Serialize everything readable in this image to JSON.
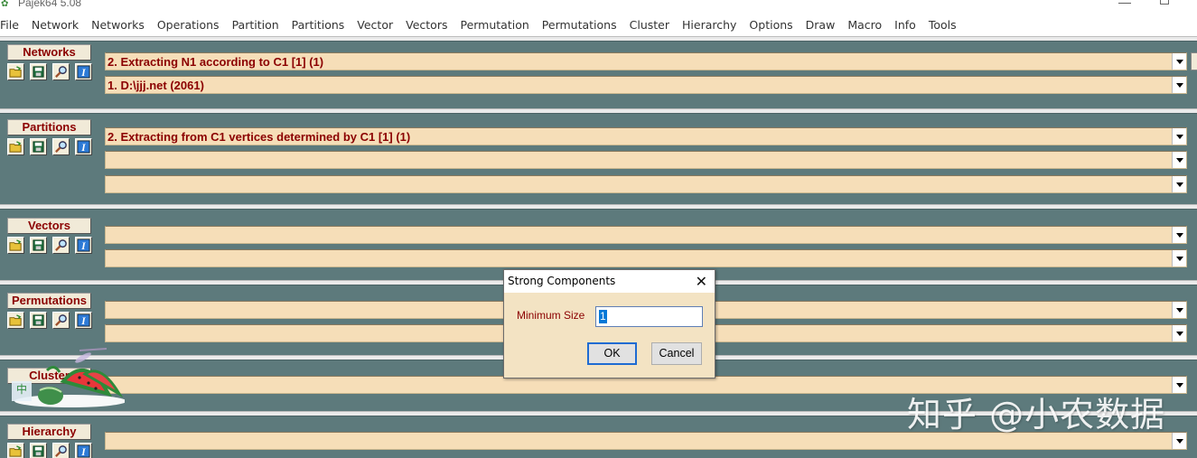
{
  "window": {
    "title": "Pajek64 5.08"
  },
  "menu": [
    "File",
    "Network",
    "Networks",
    "Operations",
    "Partition",
    "Partitions",
    "Vector",
    "Vectors",
    "Permutation",
    "Permutations",
    "Cluster",
    "Hierarchy",
    "Options",
    "Draw",
    "Macro",
    "Info",
    "Tools"
  ],
  "sections": {
    "networks": {
      "label": "Networks",
      "items": [
        "2. Extracting N1 according to C1 [1] (1)",
        "1. D:\\jjj.net (2061)"
      ]
    },
    "partitions": {
      "label": "Partitions",
      "items": [
        "2. Extracting from C1 vertices determined by C1 [1] (1)",
        "",
        ""
      ]
    },
    "vectors": {
      "label": "Vectors",
      "items": [
        "",
        ""
      ]
    },
    "permutations": {
      "label": "Permutations",
      "items": [
        "",
        ""
      ]
    },
    "cluster": {
      "label": "Cluster",
      "items": [
        ""
      ]
    },
    "hierarchy": {
      "label": "Hierarchy",
      "items": [
        ""
      ]
    }
  },
  "toolbar_icons": [
    "open-folder-icon",
    "save-icon",
    "magnifier-icon",
    "info-icon"
  ],
  "dialog": {
    "title": "Strong Components",
    "min_size_label": "Minimum Size",
    "min_size_value": "1",
    "ok_label": "OK",
    "cancel_label": "Cancel"
  },
  "watermark": {
    "text": "知乎 @小农数据"
  },
  "colors": {
    "background": "#5d7a7c",
    "combo_fill": "#f6deb8",
    "label_text": "#8b0000",
    "dialog_fill": "#f3e3c3"
  }
}
